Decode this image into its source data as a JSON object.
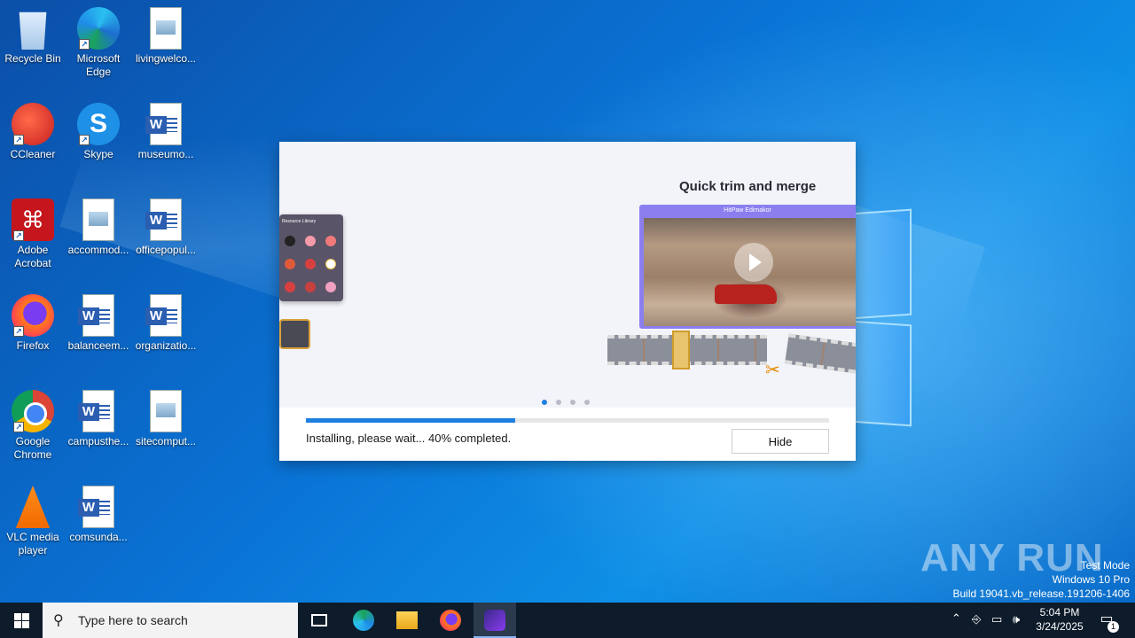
{
  "desktop_icons": [
    {
      "label": "Recycle Bin",
      "icon": "recycle-bin-icon"
    },
    {
      "label": "Microsoft Edge",
      "icon": "edge-icon"
    },
    {
      "label": "livingwelco...",
      "icon": "image-file-icon"
    },
    {
      "label": "CCleaner",
      "icon": "ccleaner-icon"
    },
    {
      "label": "Skype",
      "icon": "skype-icon"
    },
    {
      "label": "museumo...",
      "icon": "word-doc-icon"
    },
    {
      "label": "Adobe Acrobat",
      "icon": "acrobat-icon"
    },
    {
      "label": "accommod...",
      "icon": "image-file-icon"
    },
    {
      "label": "officepopul...",
      "icon": "word-doc-icon"
    },
    {
      "label": "Firefox",
      "icon": "firefox-icon"
    },
    {
      "label": "balanceem...",
      "icon": "word-doc-icon"
    },
    {
      "label": "organizatio...",
      "icon": "word-doc-icon"
    },
    {
      "label": "Google Chrome",
      "icon": "chrome-icon"
    },
    {
      "label": "campusthe...",
      "icon": "word-doc-icon"
    },
    {
      "label": "sitecomput...",
      "icon": "image-file-icon"
    },
    {
      "label": "VLC media player",
      "icon": "vlc-icon"
    },
    {
      "label": "comsunda...",
      "icon": "word-doc-icon"
    }
  ],
  "installer": {
    "slide_title": "Quick trim and merge",
    "editor_header": "HitPaw Edimakor",
    "resource_library_title": "Resource Library",
    "progress_percent": 40,
    "status_text": "Installing, please wait... 40% completed.",
    "hide_label": "Hide",
    "slides_total": 4,
    "active_slide": 1,
    "accent_color": "#1f7fe0"
  },
  "watermark": {
    "brand": "ANY RUN",
    "test_mode": "Test Mode",
    "edition": "Windows 10 Pro",
    "build": "Build 19041.vb_release.191206-1406"
  },
  "taskbar": {
    "search_placeholder": "Type here to search",
    "pinned": [
      "task-view-icon",
      "edge-icon",
      "file-explorer-icon",
      "firefox-icon",
      "edimakor-icon"
    ],
    "time": "5:04 PM",
    "date": "3/24/2025",
    "notification_count": "1"
  }
}
